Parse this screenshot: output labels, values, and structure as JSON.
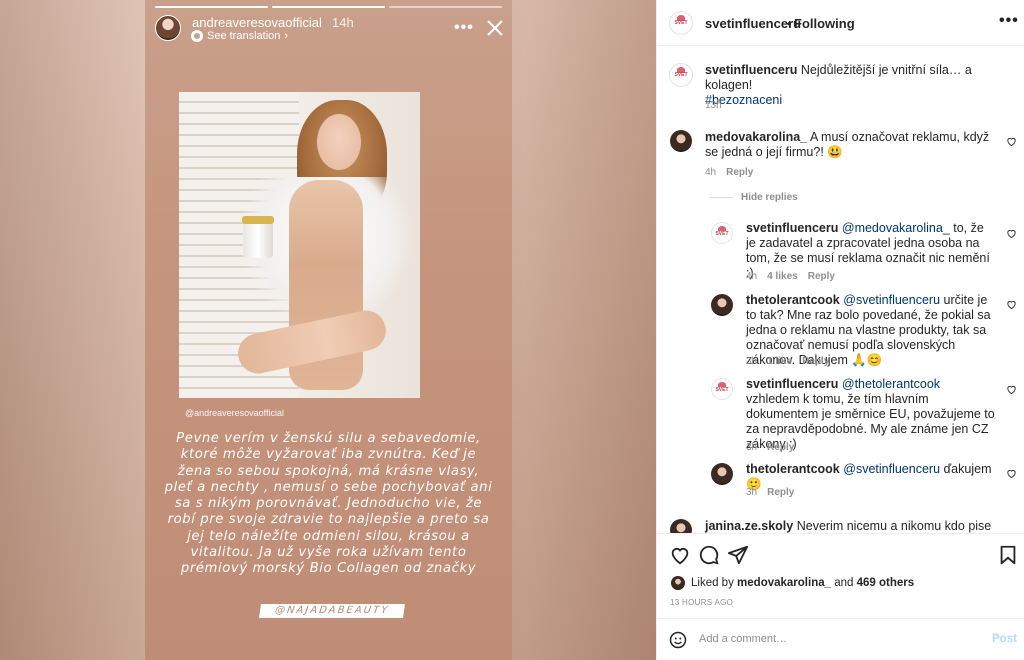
{
  "story": {
    "username": "andreaveresovaofficial",
    "time": "14h",
    "translate": "See translation",
    "photo_tag": "@andreaveresovaofficial",
    "text": "Pevne verím v ženskú silu a sebavedomie, ktoré môže vyžarovať iba zvnútra. Keď je žena so sebou spokojná, má krásne vlasy, pleť a nechty , nemusí o sebe pochybovať ani sa s nikým porovnávať. Jednoducho vie, že robí pre svoje zdravie to najlepšie a preto sa jej telo náležíte odmieni silou, krásou a vitalitou. Ja už vyše roka užívam tento prémiový morský Bio Collagen od značky",
    "brand_tag": "@NAJADABEAUTY"
  },
  "panel": {
    "header": {
      "username": "svetinfluenceru",
      "dot": "•",
      "follow": "Following"
    },
    "caption": {
      "username": "svetinfluenceru",
      "text": "Nejdůležitější je vnitřní síla… a kolagen!",
      "hashtag": "#bezoznaceni",
      "time": "13h"
    },
    "comments": [
      {
        "username": "medovakarolina_",
        "text": "A musí označovat reklamu, když se jedná o její firmu?! 😃",
        "time": "4h",
        "likes": "",
        "reply": "Reply"
      },
      {
        "username": "svetinfluenceru",
        "mention": "@medovakarolina_",
        "text": "to, že je zadavatel a zpracovatel jedna osoba na tom, že se musí reklama označit nic nemění :)",
        "time": "4h",
        "likes": "4 likes",
        "reply": "Reply"
      },
      {
        "username": "thetolerantcook",
        "mention": "@svetinfluenceru",
        "text": "určite je to tak? Mne raz bolo povedané, že pokial sa jedna o reklamu na vlastne produkty, tak sa označovať nemusí podľa slovenských zákonov. Dakujem 🙏😊",
        "time": "3h",
        "likes": "1 like",
        "reply": "Reply"
      },
      {
        "username": "svetinfluenceru",
        "mention": "@thetolerantcook",
        "text": "vzhledem k tomu, že tím hlavním dokumentem je směrnice EU, považujeme to za nepravděpodobné. My ale známe jen CZ zákony :)",
        "time": "3h",
        "likes": "",
        "reply": "Reply"
      },
      {
        "username": "thetolerantcook",
        "mention": "@svetinfluenceru",
        "text": "ďakujem 🙂",
        "time": "3h",
        "likes": "",
        "reply": "Reply"
      },
      {
        "username": "janina.ze.skoly",
        "text": "Neverim nicemu a nikomu kdo pise comic",
        "time": "",
        "likes": "",
        "reply": ""
      }
    ],
    "hide_replies": "Hide replies",
    "liked": {
      "prefix": "Liked by",
      "user": "medovakarolina_",
      "middle": "and",
      "count": "469 others"
    },
    "ago": "13 HOURS AGO",
    "add_comment": {
      "placeholder": "Add a comment…",
      "post": "Post"
    }
  },
  "colors": {
    "link": "#00376b",
    "muted": "#8e8e8e",
    "post_disabled": "#b3dbff",
    "text": "#262626"
  }
}
